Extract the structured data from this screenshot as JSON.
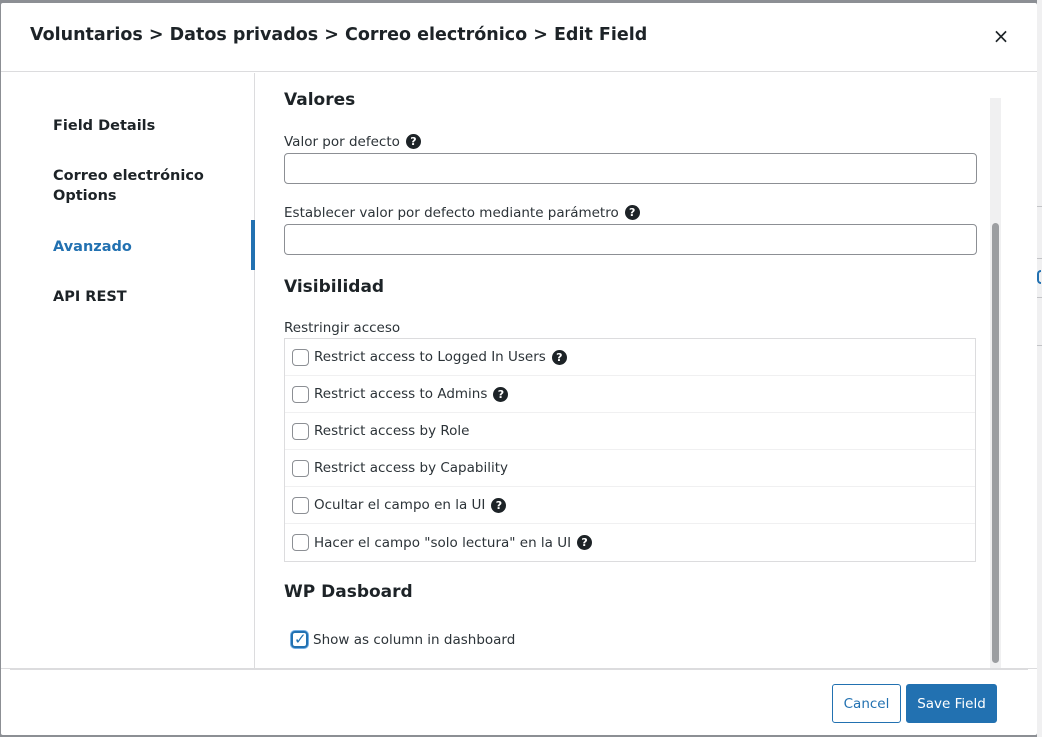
{
  "header": {
    "title": "Voluntarios > Datos privados > Correo electrónico > Edit Field",
    "close_glyph": "×"
  },
  "sidebar": {
    "items": [
      {
        "label": "Field Details",
        "active": false
      },
      {
        "label": "Correo electrónico Options",
        "active": false
      },
      {
        "label": "Avanzado",
        "active": true
      },
      {
        "label": "API REST",
        "active": false
      }
    ]
  },
  "content": {
    "valores_title": "Valores",
    "default_value_label": "Valor por defecto",
    "default_value": "",
    "param_default_label": "Establecer valor por defecto mediante parámetro",
    "param_default_value": "",
    "visibility_title": "Visibilidad",
    "restrict_label": "Restringir acceso",
    "restrictions": [
      {
        "label": "Restrict access to Logged In Users",
        "checked": false,
        "help": true
      },
      {
        "label": "Restrict access to Admins",
        "checked": false,
        "help": true
      },
      {
        "label": "Restrict access by Role",
        "checked": false,
        "help": false
      },
      {
        "label": "Restrict access by Capability",
        "checked": false,
        "help": false
      },
      {
        "label": "Ocultar el campo en la UI",
        "checked": false,
        "help": true
      },
      {
        "label": "Hacer el campo \"solo lectura\" en la UI",
        "checked": false,
        "help": true
      }
    ],
    "dashboard_title": "WP Dasboard",
    "dashboard_option": {
      "label": "Show as column in dashboard",
      "checked": true
    }
  },
  "footer": {
    "cancel_label": "Cancel",
    "save_label": "Save Field"
  },
  "colors": {
    "accent": "#2271b1",
    "text": "#1d2327",
    "border": "#dcdcde"
  },
  "icons": {
    "help": "question-circle-icon",
    "close": "close-icon",
    "check": "checkmark-icon"
  },
  "help_glyph": "?"
}
